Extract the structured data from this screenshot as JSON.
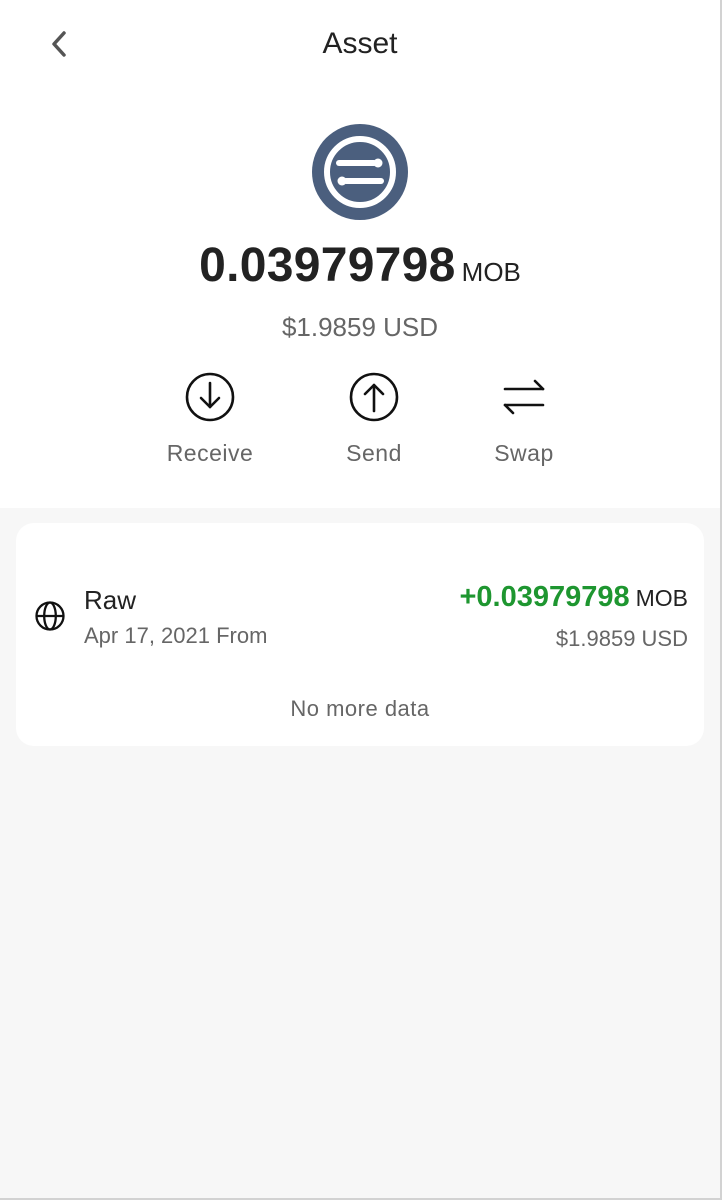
{
  "header": {
    "title": "Asset",
    "back_icon": "chevron-left-icon"
  },
  "asset": {
    "logo_icon": "mobilecoin-logo",
    "logo_color": "#4b5f7e",
    "balance": "0.03979798",
    "unit": "MOB",
    "usd_value": "$1.9859 USD"
  },
  "actions": [
    {
      "label": "Receive",
      "icon": "arrow-down-circle-icon"
    },
    {
      "label": "Send",
      "icon": "arrow-up-circle-icon"
    },
    {
      "label": "Swap",
      "icon": "swap-arrows-icon"
    }
  ],
  "transactions": [
    {
      "icon": "globe-icon",
      "name": "Raw",
      "date_from": "Apr 17, 2021 From",
      "amount": "+0.03979798",
      "unit": "MOB",
      "usd_value": "$1.9859 USD",
      "amount_color": "#1e9630"
    }
  ],
  "list_footer": "No more data"
}
